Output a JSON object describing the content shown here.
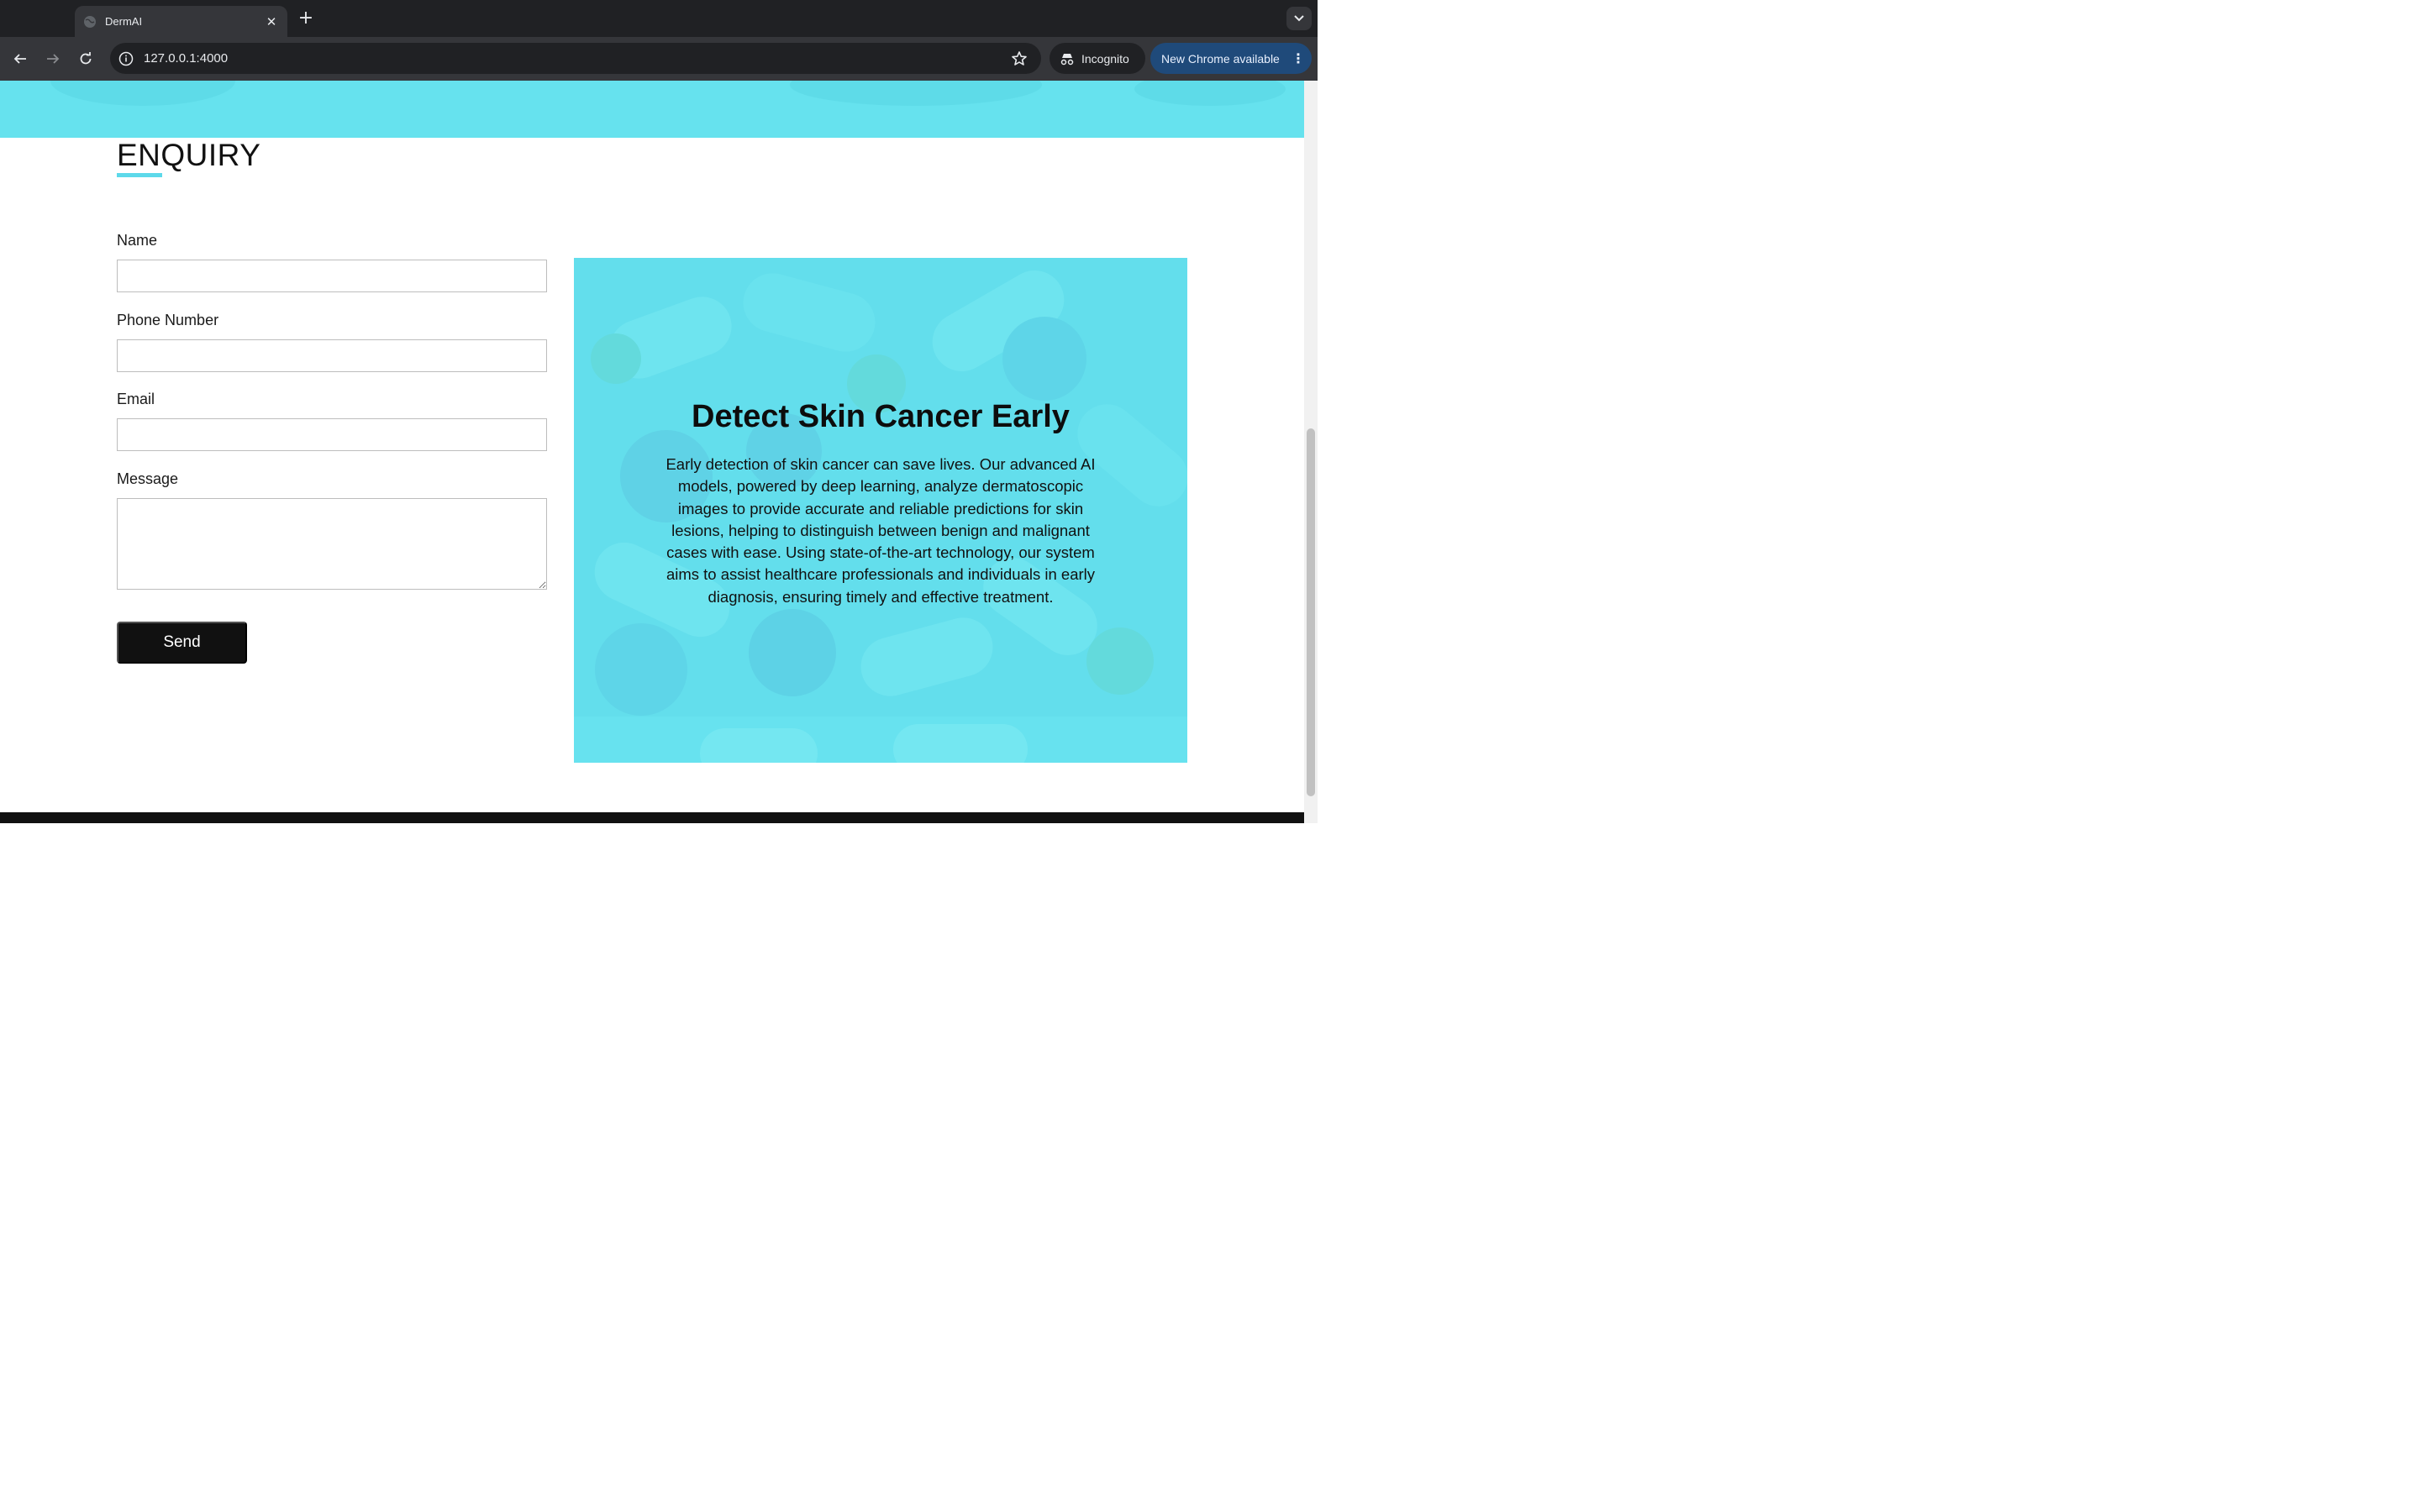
{
  "browser": {
    "tab_title": "DermAI",
    "url": "127.0.0.1:4000",
    "incognito_label": "Incognito",
    "update_label": "New Chrome available"
  },
  "enquiry": {
    "title": "ENQUIRY",
    "fields": [
      {
        "label": "Name",
        "value": ""
      },
      {
        "label": "Phone Number",
        "value": ""
      },
      {
        "label": "Email",
        "value": ""
      },
      {
        "label": "Message",
        "value": ""
      }
    ],
    "send_label": "Send"
  },
  "info": {
    "title": "Detect Skin Cancer Early",
    "body": "Early detection of skin cancer can save lives. Our advanced AI models, powered by deep learning, analyze dermatoscopic images to provide accurate and reliable predictions for skin lesions, helping to distinguish between benign and malignant cases with ease. Using state-of-the-art technology, our system aims to assist healthcare professionals and individuals in early diagnosis, ensuring timely and effective treatment."
  },
  "colors": {
    "accent": "#66e2ee",
    "button": "#111111",
    "browser_bg": "#202124"
  }
}
